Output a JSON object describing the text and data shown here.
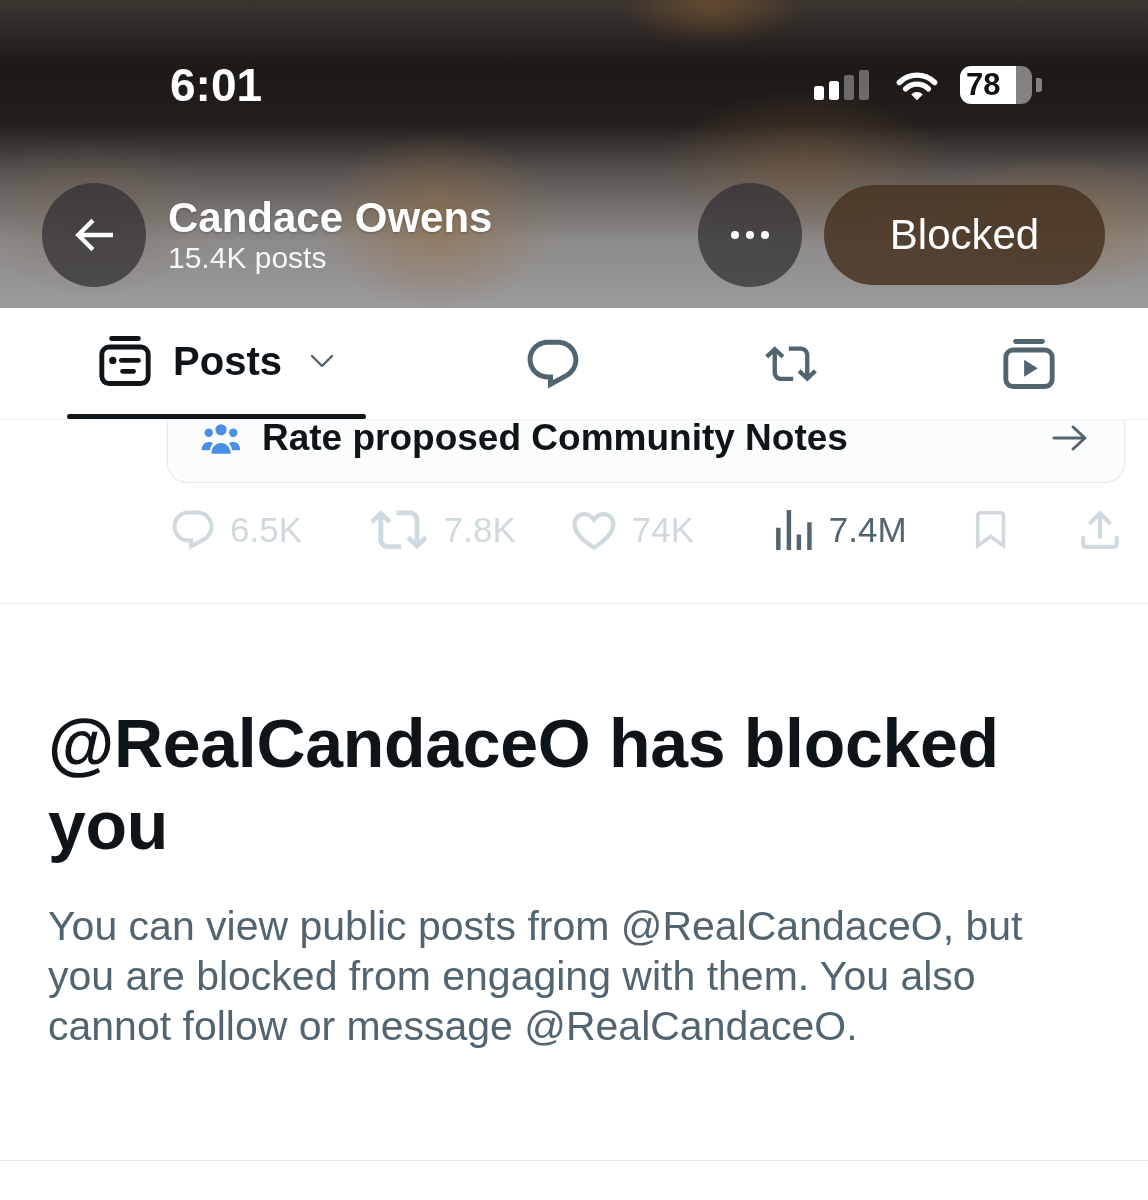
{
  "status_bar": {
    "time": "6:01",
    "battery": "78"
  },
  "header": {
    "title": "Candace Owens",
    "subtitle": "15.4K posts",
    "relationship_button": "Blocked"
  },
  "tabs": [
    {
      "kind": "posts",
      "label": "Posts",
      "selected": true
    },
    {
      "kind": "replies",
      "selected": false
    },
    {
      "kind": "reposts",
      "selected": false
    },
    {
      "kind": "videos",
      "selected": false
    }
  ],
  "post": {
    "community_notes_prompt": "Rate proposed Community Notes",
    "actions": [
      {
        "kind": "reply",
        "count": "6.5K",
        "disabled": true
      },
      {
        "kind": "repost",
        "count": "7.8K",
        "disabled": true
      },
      {
        "kind": "like",
        "count": "74K",
        "disabled": true
      },
      {
        "kind": "views",
        "count": "7.4M",
        "disabled": false
      },
      {
        "kind": "bookmark",
        "disabled": true
      },
      {
        "kind": "share",
        "disabled": true
      }
    ]
  },
  "blocked_notice": {
    "title": "@RealCandaceO has blocked you",
    "message": "You can view public posts from @RealCandaceO, but you are blocked from engaging with them. You also cannot follow or message @RealCandaceO."
  }
}
